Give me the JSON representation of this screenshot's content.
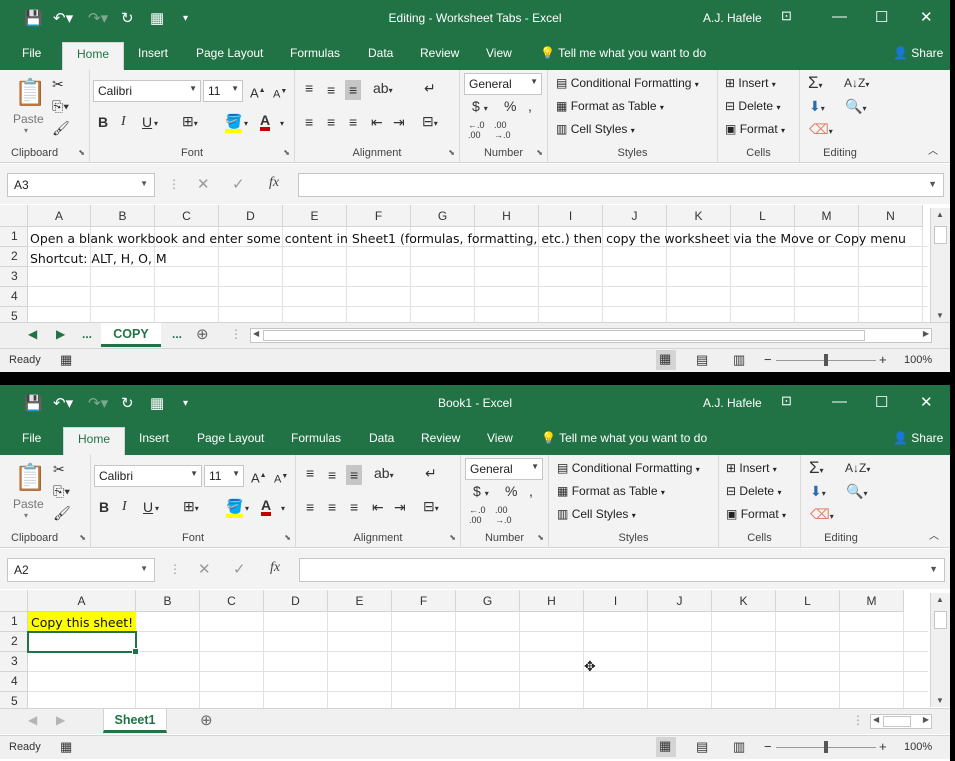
{
  "windows": [
    {
      "title": "Editing - Worksheet Tabs  -  Excel",
      "user": "A.J. Hafele",
      "tabs": [
        "File",
        "Home",
        "Insert",
        "Page Layout",
        "Formulas",
        "Data",
        "Review",
        "View"
      ],
      "tell_me": "Tell me what you want to do",
      "share": "Share",
      "font_name": "Calibri",
      "font_size": "11",
      "number_format": "General",
      "name_box": "A3",
      "columns": [
        "A",
        "B",
        "C",
        "D",
        "E",
        "F",
        "G",
        "H",
        "I",
        "J",
        "K",
        "L",
        "M",
        "N"
      ],
      "rows": [
        "1",
        "2",
        "3",
        "4",
        "5"
      ],
      "cells": {
        "A1": "Open a blank workbook and enter some content in Sheet1 (formulas, formatting, etc.) then copy the worksheet via the Move or Copy menu",
        "A2": "Shortcut: ALT, H, O, M"
      },
      "sheet_tabs": [
        "...",
        "COPY",
        "..."
      ],
      "status": "Ready",
      "zoom": "100%"
    },
    {
      "title": "Book1  -  Excel",
      "user": "A.J. Hafele",
      "tabs": [
        "File",
        "Home",
        "Insert",
        "Page Layout",
        "Formulas",
        "Data",
        "Review",
        "View"
      ],
      "tell_me": "Tell me what you want to do",
      "share": "Share",
      "font_name": "Calibri",
      "font_size": "11",
      "number_format": "General",
      "name_box": "A2",
      "columns": [
        "A",
        "B",
        "C",
        "D",
        "E",
        "F",
        "G",
        "H",
        "I",
        "J",
        "K",
        "L",
        "M"
      ],
      "rows": [
        "1",
        "2",
        "3",
        "4",
        "5"
      ],
      "cells": {
        "A1": "Copy this sheet!"
      },
      "sheet_tabs": [
        "Sheet1"
      ],
      "status": "Ready",
      "zoom": "100%"
    }
  ],
  "ribbon": {
    "paste": "Paste",
    "clipboard": "Clipboard",
    "font": "Font",
    "alignment": "Alignment",
    "number": "Number",
    "styles": "Styles",
    "cells": "Cells",
    "editing": "Editing",
    "conditional_formatting": "Conditional Formatting",
    "format_as_table": "Format as Table",
    "cell_styles": "Cell Styles",
    "insert": "Insert",
    "delete": "Delete",
    "format": "Format",
    "bold": "B",
    "italic": "I",
    "underline": "U"
  },
  "icons": {
    "save": "save-icon",
    "undo": "undo-icon",
    "redo": "redo-icon",
    "refresh": "refresh-icon",
    "lightbulb": "lightbulb-icon",
    "person": "person-icon"
  }
}
